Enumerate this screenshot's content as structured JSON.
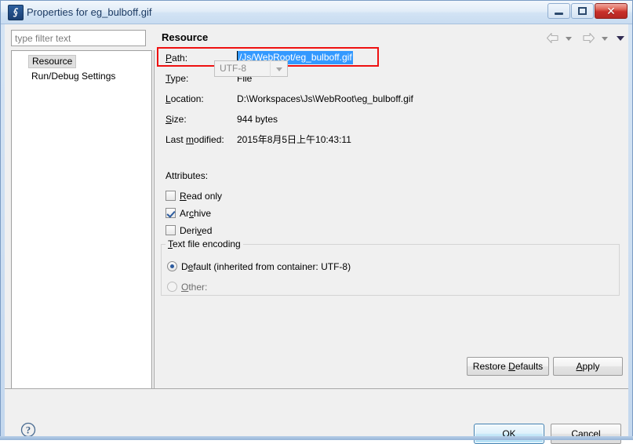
{
  "window": {
    "title": "Properties for eg_bulboff.gif",
    "icon": "properties-icon",
    "buttons": {
      "minimize": "minimize-icon",
      "maximize": "maximize-icon",
      "close": "close-icon",
      "close_glyph": "✕"
    }
  },
  "sidebar": {
    "filter": {
      "placeholder": "type filter text",
      "value": ""
    },
    "items": [
      {
        "label": "Resource",
        "selected": true
      },
      {
        "label": "Run/Debug Settings",
        "selected": false
      }
    ]
  },
  "content": {
    "title": "Resource",
    "nav": {
      "back": "back-arrow-icon",
      "back_menu": "chevron-down-icon",
      "forward": "forward-arrow-icon",
      "forward_menu": "chevron-down-icon",
      "page_menu": "chevron-down-icon"
    },
    "properties": [
      {
        "label_pre": "",
        "label_mn": "P",
        "label_post": "ath:",
        "value": "/Js/WebRoot/eg_bulboff.gif",
        "highlighted": true
      },
      {
        "label_pre": "",
        "label_mn": "T",
        "label_post": "ype:",
        "value": "File"
      },
      {
        "label_pre": "",
        "label_mn": "L",
        "label_post": "ocation:",
        "value": "D:\\Workspaces\\Js\\WebRoot\\eg_bulboff.gif"
      },
      {
        "label_pre": "",
        "label_mn": "S",
        "label_post": "ize:",
        "value": "944  bytes"
      },
      {
        "label_pre": "Last ",
        "label_mn": "m",
        "label_post": "odified:",
        "value": "2015年8月5日上午10:43:11"
      }
    ],
    "attributes": {
      "title": "Attributes:",
      "items": [
        {
          "pre": "",
          "mn": "R",
          "post": "ead only",
          "checked": false
        },
        {
          "pre": "Ar",
          "mn": "c",
          "post": "hive",
          "checked": true
        },
        {
          "pre": "Deri",
          "mn": "v",
          "post": "ed",
          "checked": false
        }
      ]
    },
    "encoding": {
      "legend_pre": "",
      "legend_mn": "T",
      "legend_post": "ext file encoding",
      "default_pre": "D",
      "default_mn": "e",
      "default_post": "fault (inherited from container: UTF-8)",
      "default_selected": true,
      "other_pre": "",
      "other_mn": "O",
      "other_post": "ther:",
      "other_selected": false,
      "combo_value": "UTF-8",
      "combo_enabled": false
    },
    "buttons": {
      "restore_pre": "Restore ",
      "restore_mn": "D",
      "restore_post": "efaults",
      "apply_pre": "",
      "apply_mn": "A",
      "apply_post": "pply"
    }
  },
  "footer": {
    "help": "help-icon",
    "ok": "OK",
    "cancel": "Cancel"
  },
  "colors": {
    "selection_blue": "#3399ff",
    "annotation_red": "#ee1111",
    "dialog_bg": "#f0f0f0",
    "accent": "#3c7fb1"
  }
}
